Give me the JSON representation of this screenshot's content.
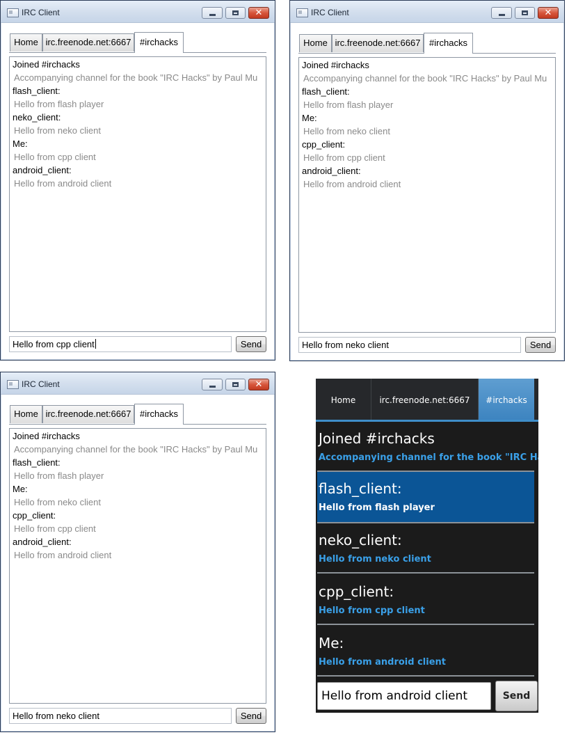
{
  "window1": {
    "title": "IRC Client",
    "tabs": [
      "Home",
      "irc.freenode.net:6667",
      "#irchacks"
    ],
    "joined": "Joined #irchacks",
    "topic": "Accompanying channel for the book \"IRC Hacks\" by  Paul Mu",
    "messages": [
      {
        "nick": "flash_client:",
        "text": "Hello from flash player"
      },
      {
        "nick": "neko_client:",
        "text": "Hello from neko client"
      },
      {
        "nick": "Me:",
        "text": "Hello from cpp client"
      },
      {
        "nick": "android_client:",
        "text": "Hello from android client"
      }
    ],
    "input_value": "Hello from cpp client",
    "send_label": "Send"
  },
  "window2": {
    "title": "IRC Client",
    "tabs": [
      "Home",
      "irc.freenode.net:6667",
      "#irchacks"
    ],
    "joined": "Joined #irchacks",
    "topic": "Accompanying channel for the book \"IRC Hacks\" by  Paul Mu",
    "messages": [
      {
        "nick": "flash_client:",
        "text": "Hello from flash player"
      },
      {
        "nick": "Me:",
        "text": "Hello from neko client"
      },
      {
        "nick": "cpp_client:",
        "text": "Hello from cpp client"
      },
      {
        "nick": "android_client:",
        "text": "Hello from android client"
      }
    ],
    "input_value": "Hello from neko client",
    "send_label": "Send"
  },
  "window3": {
    "title": "IRC Client",
    "tabs": [
      "Home",
      "irc.freenode.net:6667",
      "#irchacks"
    ],
    "joined": "Joined #irchacks",
    "topic": "Accompanying channel for the book \"IRC Hacks\" by  Paul Mu",
    "messages": [
      {
        "nick": "flash_client:",
        "text": "Hello from flash player"
      },
      {
        "nick": "Me:",
        "text": "Hello from neko client"
      },
      {
        "nick": "cpp_client:",
        "text": "Hello from cpp client"
      },
      {
        "nick": "android_client:",
        "text": "Hello from android client"
      }
    ],
    "input_value": "Hello from neko client",
    "send_label": "Send"
  },
  "android": {
    "tabs": [
      "Home",
      "irc.freenode.net:6667",
      "#irchacks"
    ],
    "joined": "Joined #irchacks",
    "topic": "Accompanying channel for the book \"IRC Hacks\"",
    "messages": [
      {
        "nick": "flash_client:",
        "text": "Hello from flash player"
      },
      {
        "nick": "neko_client:",
        "text": "Hello from neko client"
      },
      {
        "nick": "cpp_client:",
        "text": "Hello from cpp client"
      },
      {
        "nick": "Me:",
        "text": "Hello from android client"
      }
    ],
    "input_value": "Hello from android client",
    "send_label": "Send"
  },
  "colors": {
    "android_accent": "#3aa0e8",
    "android_selected": "#0b5596",
    "desktop_message_text": "#8a8a8a",
    "close_button": "#c23a20"
  },
  "icons": [
    "window-app-icon",
    "minimize-icon",
    "maximize-icon",
    "close-icon"
  ]
}
